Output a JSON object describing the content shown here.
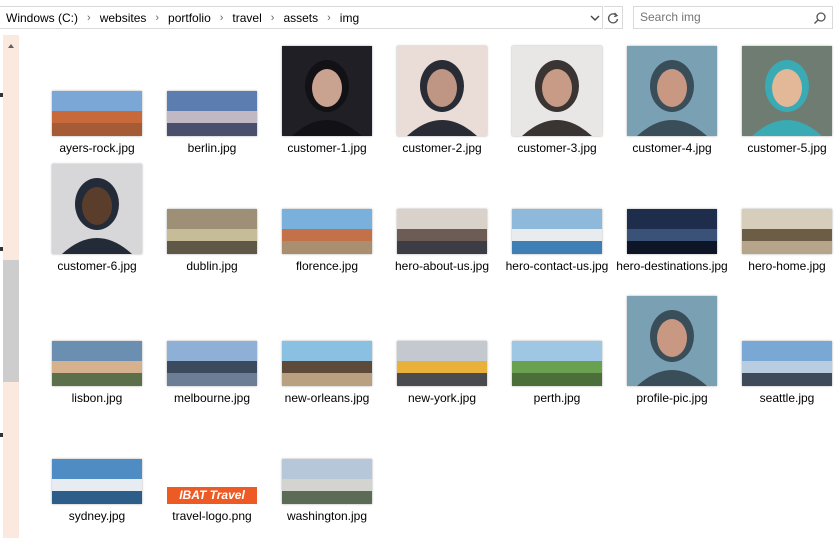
{
  "address": {
    "path": [
      "Windows (C:)",
      "websites",
      "portfolio",
      "travel",
      "assets",
      "img"
    ],
    "separator": "›"
  },
  "search": {
    "placeholder": "Search img"
  },
  "icons": [
    "chevron-down-icon",
    "refresh-icon",
    "search-icon",
    "scroll-up-icon"
  ],
  "files": [
    {
      "name": "ayers-rock.jpg",
      "kind": "landscape",
      "colors": [
        "#7aa7d6",
        "#c8693a",
        "#a55b36"
      ]
    },
    {
      "name": "berlin.jpg",
      "kind": "landscape",
      "colors": [
        "#5c7db0",
        "#c0b9c4",
        "#4a4f6e"
      ]
    },
    {
      "name": "customer-1.jpg",
      "kind": "square",
      "colors": [
        "#1f1f25",
        "#c9a290",
        "#111116"
      ]
    },
    {
      "name": "customer-2.jpg",
      "kind": "square",
      "colors": [
        "#eadcd6",
        "#bf9683",
        "#2a2c35"
      ]
    },
    {
      "name": "customer-3.jpg",
      "kind": "square",
      "colors": [
        "#e9e7e5",
        "#c79b86",
        "#3a3433"
      ]
    },
    {
      "name": "customer-4.jpg",
      "kind": "square",
      "colors": [
        "#7aa0b3",
        "#c99883",
        "#3a4e59"
      ]
    },
    {
      "name": "customer-5.jpg",
      "kind": "square",
      "colors": [
        "#6e7c72",
        "#e3b898",
        "#3aaab4"
      ]
    },
    {
      "name": "customer-6.jpg",
      "kind": "square",
      "colors": [
        "#d7d6d8",
        "#5a3d2b",
        "#232a38"
      ]
    },
    {
      "name": "dublin.jpg",
      "kind": "landscape",
      "colors": [
        "#9d9077",
        "#c7bc98",
        "#5f5846"
      ]
    },
    {
      "name": "florence.jpg",
      "kind": "landscape",
      "colors": [
        "#7ab0dc",
        "#c4714a",
        "#a98f6f"
      ]
    },
    {
      "name": "hero-about-us.jpg",
      "kind": "landscape",
      "colors": [
        "#d9d2cb",
        "#6c5c55",
        "#3c3c44"
      ]
    },
    {
      "name": "hero-contact-us.jpg",
      "kind": "landscape",
      "colors": [
        "#8fb9da",
        "#e9ecef",
        "#3f7fb5"
      ]
    },
    {
      "name": "hero-destinations.jpg",
      "kind": "landscape",
      "colors": [
        "#1e2d4c",
        "#3a5277",
        "#0e1526"
      ]
    },
    {
      "name": "hero-home.jpg",
      "kind": "landscape",
      "colors": [
        "#d6cdbb",
        "#6c5d46",
        "#b7a58b"
      ]
    },
    {
      "name": "lisbon.jpg",
      "kind": "landscape",
      "colors": [
        "#6b8fb1",
        "#d5b28d",
        "#5c6f4b"
      ]
    },
    {
      "name": "melbourne.jpg",
      "kind": "landscape",
      "colors": [
        "#8fb0d6",
        "#3c4a5e",
        "#6b7e96"
      ]
    },
    {
      "name": "new-orleans.jpg",
      "kind": "landscape",
      "colors": [
        "#8ac0e1",
        "#5d4a3b",
        "#b9a080"
      ]
    },
    {
      "name": "new-york.jpg",
      "kind": "landscape",
      "colors": [
        "#c3c9cf",
        "#e9b13a",
        "#4a4b4f"
      ]
    },
    {
      "name": "perth.jpg",
      "kind": "landscape",
      "colors": [
        "#9fc6e2",
        "#6aa150",
        "#4c6e3a"
      ]
    },
    {
      "name": "profile-pic.jpg",
      "kind": "square",
      "colors": [
        "#7aa0b3",
        "#c99883",
        "#3a4e59"
      ]
    },
    {
      "name": "seattle.jpg",
      "kind": "landscape",
      "colors": [
        "#7aa8d4",
        "#b9cde1",
        "#3e4a5a"
      ]
    },
    {
      "name": "sydney.jpg",
      "kind": "landscape",
      "colors": [
        "#4f8cc4",
        "#e7ecf0",
        "#2d5d89"
      ]
    },
    {
      "name": "travel-logo.png",
      "kind": "logo",
      "colors": [
        "#ee5a24",
        "#ffffff",
        "#ee5a24"
      ],
      "logo_text": "IBAT Travel"
    },
    {
      "name": "washington.jpg",
      "kind": "landscape",
      "colors": [
        "#b5c7d9",
        "#d3d3d0",
        "#5c6b55"
      ]
    }
  ]
}
